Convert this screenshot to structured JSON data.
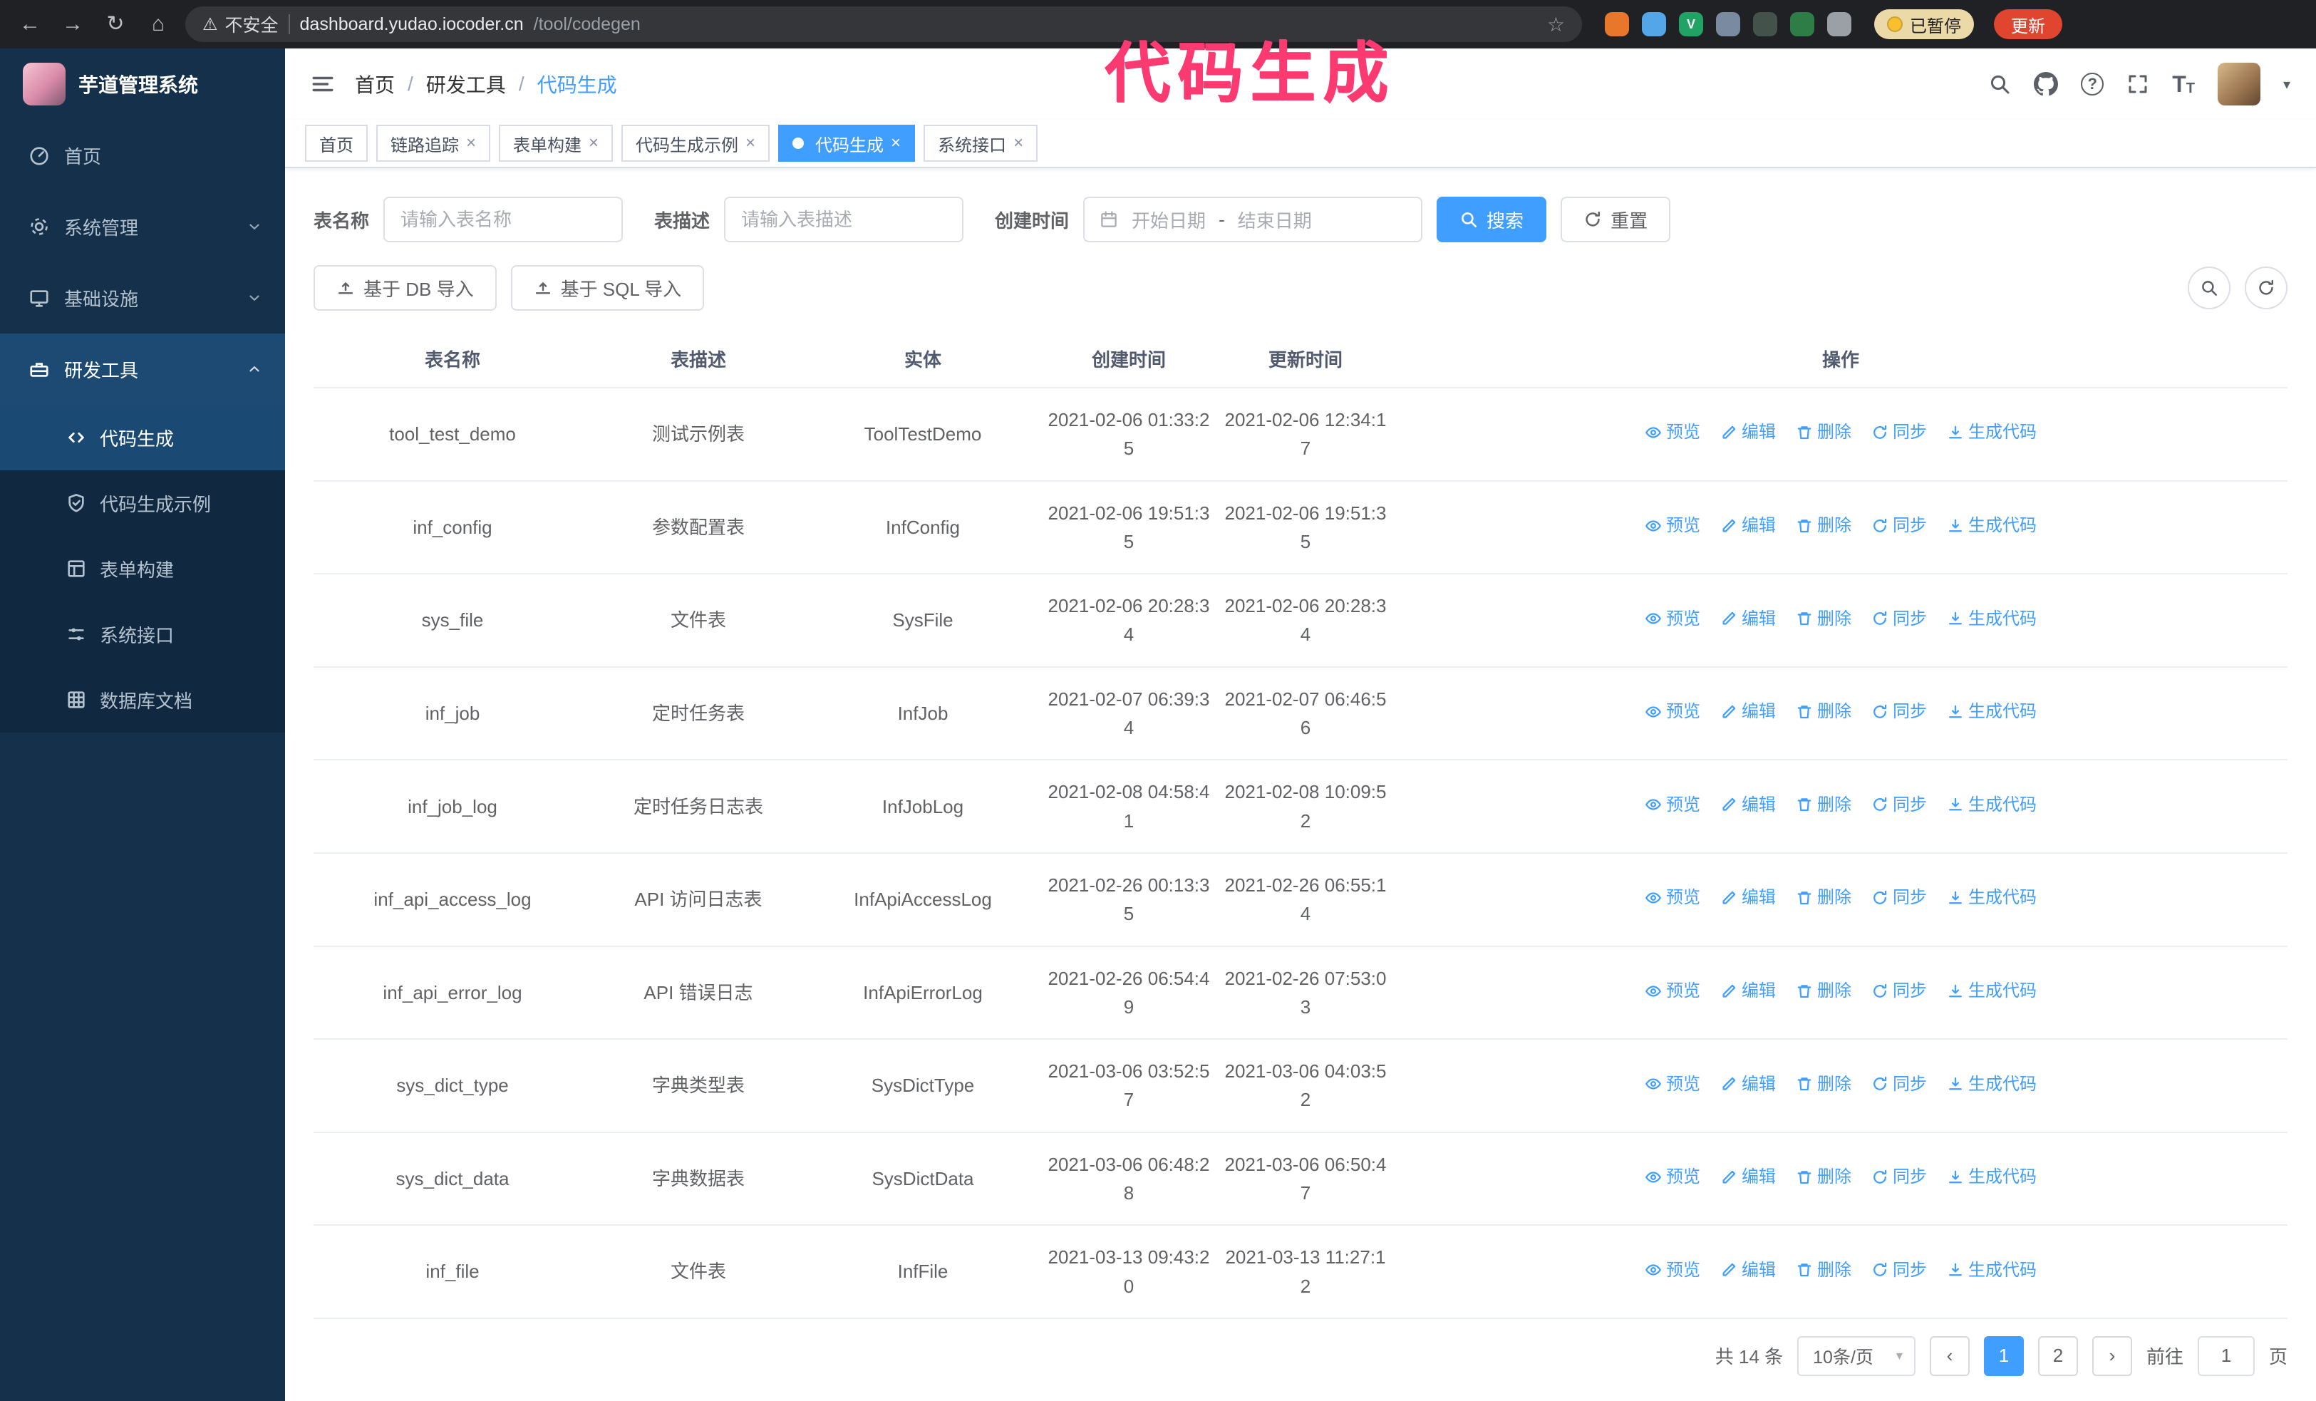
{
  "browser": {
    "security_text": "不安全",
    "url_host": "dashboard.yudao.iocoder.cn",
    "url_path": "/tool/codegen",
    "paused_label": "已暂停",
    "update_label": "更新",
    "extensions": [
      {
        "name": "fox-extension-icon",
        "color": "#e8762b",
        "glyph": ""
      },
      {
        "name": "blue-extension-icon",
        "color": "#53a7e8",
        "glyph": ""
      },
      {
        "name": "v-green-extension-icon",
        "color": "#21a366",
        "glyph": "V"
      },
      {
        "name": "people-extension-icon",
        "color": "#7a8aa0",
        "glyph": ""
      },
      {
        "name": "tray-extension-icon",
        "color": "#44524c",
        "glyph": ""
      },
      {
        "name": "leaf-extension-icon",
        "color": "#2e7d46",
        "glyph": ""
      },
      {
        "name": "puzzle-extension-icon",
        "color": "#9aa0a6",
        "glyph": ""
      }
    ]
  },
  "overlay": {
    "text": "代码生成"
  },
  "sidebar": {
    "logo_title": "芋道管理系统",
    "items": [
      {
        "label": "首页"
      },
      {
        "label": "系统管理"
      },
      {
        "label": "基础设施"
      },
      {
        "label": "研发工具"
      }
    ],
    "sub_items": [
      {
        "label": "代码生成"
      },
      {
        "label": "代码生成示例"
      },
      {
        "label": "表单构建"
      },
      {
        "label": "系统接口"
      },
      {
        "label": "数据库文档"
      }
    ]
  },
  "header": {
    "breadcrumb": {
      "home": "首页",
      "section": "研发工具",
      "current": "代码生成"
    }
  },
  "tabs": [
    {
      "label": "首页"
    },
    {
      "label": "链路追踪"
    },
    {
      "label": "表单构建"
    },
    {
      "label": "代码生成示例"
    },
    {
      "label": "代码生成"
    },
    {
      "label": "系统接口"
    }
  ],
  "filters": {
    "table_name_label": "表名称",
    "table_name_placeholder": "请输入表名称",
    "table_desc_label": "表描述",
    "table_desc_placeholder": "请输入表描述",
    "create_time_label": "创建时间",
    "start_date_placeholder": "开始日期",
    "range_separator": "-",
    "end_date_placeholder": "结束日期",
    "search_button": "搜索",
    "reset_button": "重置"
  },
  "toolbar": {
    "import_db": "基于 DB 导入",
    "import_sql": "基于 SQL 导入"
  },
  "table": {
    "columns": [
      "表名称",
      "表描述",
      "实体",
      "创建时间",
      "更新时间",
      "操作"
    ],
    "actions": [
      {
        "label": "预览",
        "icon": "eye",
        "name": "preview-link"
      },
      {
        "label": "编辑",
        "icon": "edit",
        "name": "edit-link"
      },
      {
        "label": "删除",
        "icon": "trash",
        "name": "delete-link"
      },
      {
        "label": "同步",
        "icon": "sync",
        "name": "sync-link"
      },
      {
        "label": "生成代码",
        "icon": "gen",
        "name": "generate-code-link"
      }
    ],
    "rows": [
      {
        "name": "tool_test_demo",
        "desc": "测试示例表",
        "entity": "ToolTestDemo",
        "created": "2021-02-06 01:33:25",
        "updated": "2021-02-06 12:34:17"
      },
      {
        "name": "inf_config",
        "desc": "参数配置表",
        "entity": "InfConfig",
        "created": "2021-02-06 19:51:35",
        "updated": "2021-02-06 19:51:35"
      },
      {
        "name": "sys_file",
        "desc": "文件表",
        "entity": "SysFile",
        "created": "2021-02-06 20:28:34",
        "updated": "2021-02-06 20:28:34"
      },
      {
        "name": "inf_job",
        "desc": "定时任务表",
        "entity": "InfJob",
        "created": "2021-02-07 06:39:34",
        "updated": "2021-02-07 06:46:56"
      },
      {
        "name": "inf_job_log",
        "desc": "定时任务日志表",
        "entity": "InfJobLog",
        "created": "2021-02-08 04:58:41",
        "updated": "2021-02-08 10:09:52"
      },
      {
        "name": "inf_api_access_log",
        "desc": "API 访问日志表",
        "entity": "InfApiAccessLog",
        "created": "2021-02-26 00:13:35",
        "updated": "2021-02-26 06:55:14"
      },
      {
        "name": "inf_api_error_log",
        "desc": "API 错误日志",
        "entity": "InfApiErrorLog",
        "created": "2021-02-26 06:54:49",
        "updated": "2021-02-26 07:53:03"
      },
      {
        "name": "sys_dict_type",
        "desc": "字典类型表",
        "entity": "SysDictType",
        "created": "2021-03-06 03:52:57",
        "updated": "2021-03-06 04:03:52"
      },
      {
        "name": "sys_dict_data",
        "desc": "字典数据表",
        "entity": "SysDictData",
        "created": "2021-03-06 06:48:28",
        "updated": "2021-03-06 06:50:47"
      },
      {
        "name": "inf_file",
        "desc": "文件表",
        "entity": "InfFile",
        "created": "2021-03-13 09:43:20",
        "updated": "2021-03-13 11:27:12"
      }
    ]
  },
  "pagination": {
    "total_text": "共 14 条",
    "page_size": "10条/页",
    "pages": [
      "1",
      "2"
    ],
    "goto_label": "前往",
    "goto_value": "1",
    "page_unit": "页"
  },
  "icons": {
    "back": "←",
    "forward": "→",
    "reload": "↻",
    "home": "⌂",
    "warning": "⚠",
    "star": "☆",
    "question": "?",
    "caret": "▾",
    "close": "×",
    "prev": "‹",
    "next": "›",
    "font_big": "T",
    "font_small": "T"
  },
  "colors": {
    "accent": "#409eff",
    "sidebar_bg": "#15304a",
    "sidebar_highlight": "#1d4a73",
    "overlay_pink": "#fb3a72",
    "update_red": "#e0452f",
    "chrome_bg": "#202124"
  }
}
